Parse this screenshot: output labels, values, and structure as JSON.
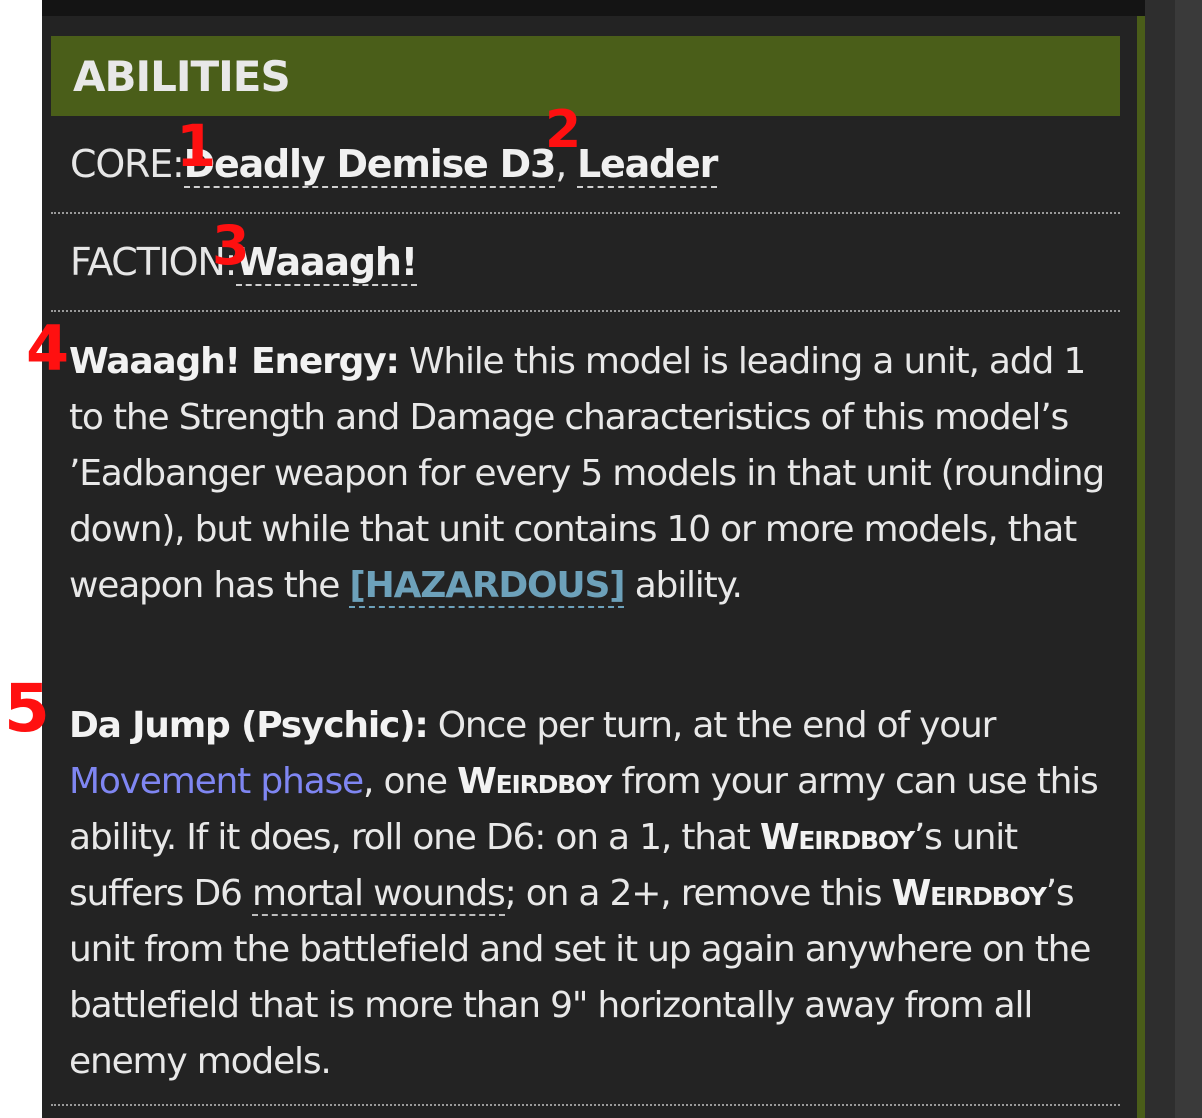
{
  "header": {
    "title": "ABILITIES"
  },
  "core": {
    "label": "CORE:",
    "items": [
      "Deadly Demise D3",
      "Leader"
    ],
    "separator": ","
  },
  "faction": {
    "label": "FACTION:",
    "items": [
      "Waaagh!"
    ]
  },
  "abilities": [
    {
      "name": "Waaagh! Energy:",
      "text_1": "While this model is leading a unit, add 1 to the Strength and Damage characteristics of this model’s ’Eadbanger weapon for every 5 models in that unit (rounding down), but while that unit contains 10 or more models, that weapon has the",
      "keyword": "[HAZARDOUS]",
      "text_2": "ability."
    },
    {
      "name": "Da Jump (Psychic):",
      "t1": "Once per turn, at the end of your",
      "link": "Movement phase",
      "t2": ", one",
      "kw": "Weirdboy",
      "t3": "from your army can use this ability. If it does, roll one D6: on a 1, that",
      "t4": "’s unit suffers D6",
      "mortal": "mortal wounds",
      "t5": "; on a 2+, remove this",
      "t6": "’s unit from the battlefield and set it up again anywhere on the battlefield that is more than 9\" horizontally away from all enemy models."
    }
  ],
  "annotations": [
    "1",
    "2",
    "3",
    "4",
    "5"
  ],
  "colors": {
    "header_bg": "#4a5e19",
    "panel_bg": "#232323",
    "link": "#7f86f2",
    "hazard": "#6da1ba",
    "annotation": "#ff1010"
  }
}
